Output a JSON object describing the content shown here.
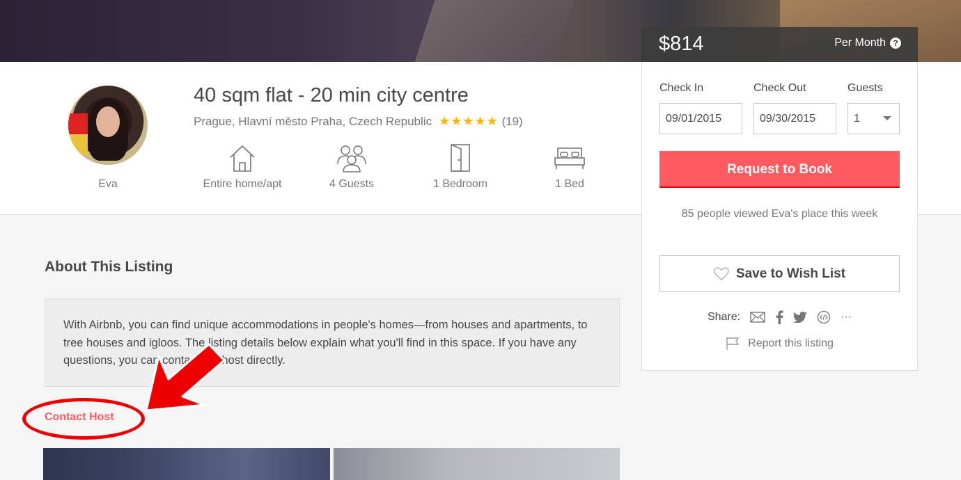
{
  "listing": {
    "title": "40 sqm flat - 20 min city centre",
    "location": "Prague, Hlavní město Praha, Czech Republic",
    "stars": "★★★★★",
    "rating": 5,
    "review_count": "(19)",
    "host_name": "Eva"
  },
  "amenities": [
    {
      "icon": "home-icon",
      "label": "Entire home/apt"
    },
    {
      "icon": "guests-icon",
      "label": "4 Guests"
    },
    {
      "icon": "door-icon",
      "label": "1 Bedroom"
    },
    {
      "icon": "bed-icon",
      "label": "1 Bed"
    }
  ],
  "booking": {
    "price": "$814",
    "period": "Per Month",
    "help_glyph": "?",
    "check_in_label": "Check In",
    "check_out_label": "Check Out",
    "guests_label": "Guests",
    "check_in_value": "09/01/2015",
    "check_out_value": "09/30/2015",
    "guests_value": "1",
    "request_button": "Request to Book",
    "viewed_text": "85 people viewed Eva's place this week",
    "wishlist_button": "Save to Wish List",
    "share_label": "Share:",
    "share_icons": [
      "mail-icon",
      "facebook-icon",
      "twitter-icon",
      "embed-icon",
      "more-icon"
    ],
    "more_glyph": "···",
    "report_label": "Report this listing"
  },
  "about": {
    "heading": "About This Listing",
    "description": "With Airbnb, you can find unique accommodations in people's homes—from houses and apartments, to tree houses and igloos. The listing details below explain what you'll find in this space. If you have any questions, you can contact the host directly.",
    "contact_link": "Contact Host"
  },
  "colors": {
    "brand": "#ff5a5f",
    "annotation": "#ee0000",
    "star": "#ffb400"
  }
}
